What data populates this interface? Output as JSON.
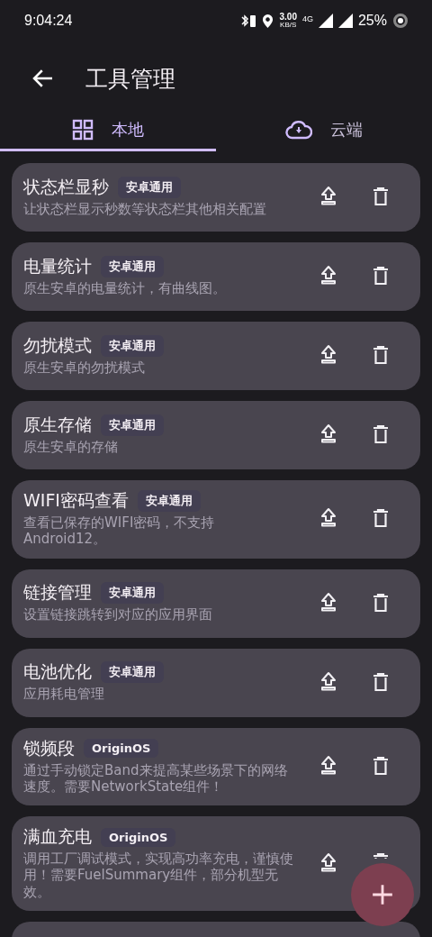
{
  "status_bar": {
    "time": "9:04:24",
    "speed": "3.00",
    "speed_unit": "KB/S",
    "network": "4G",
    "battery": "25%"
  },
  "toolbar": {
    "title": "工具管理"
  },
  "tabs": [
    {
      "label": "本地",
      "kind": "grid",
      "selected": true
    },
    {
      "label": "云端",
      "kind": "cloud",
      "selected": false
    }
  ],
  "tools": [
    {
      "name": "状态栏显秒",
      "tag": "安卓通用",
      "description": "让状态栏显示秒数等状态栏其他相关配置"
    },
    {
      "name": "电量统计",
      "tag": "安卓通用",
      "description": "原生安卓的电量统计，有曲线图。"
    },
    {
      "name": "勿扰模式",
      "tag": "安卓通用",
      "description": "原生安卓的勿扰模式"
    },
    {
      "name": "原生存储",
      "tag": "安卓通用",
      "description": "原生安卓的存储"
    },
    {
      "name": "WIFI密码查看",
      "tag": "安卓通用",
      "description": "查看已保存的WIFI密码，不支持Android12。"
    },
    {
      "name": "链接管理",
      "tag": "安卓通用",
      "description": "设置链接跳转到对应的应用界面"
    },
    {
      "name": "电池优化",
      "tag": "安卓通用",
      "description": "应用耗电管理"
    },
    {
      "name": "锁频段",
      "tag": "OriginOS",
      "description": "通过手动锁定Band来提高某些场景下的网络速度。需要NetworkState组件！"
    },
    {
      "name": "满血充电",
      "tag": "OriginOS",
      "description": "调用工厂调试模式，实现高功率充电，谨慎使用！需要FuelSummary组件，部分机型无效。"
    }
  ]
}
